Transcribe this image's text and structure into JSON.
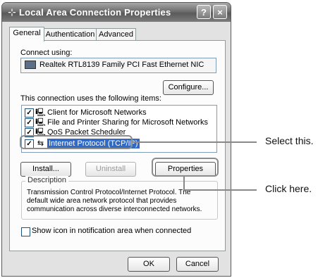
{
  "window": {
    "title": "Local Area Connection Properties",
    "help_button": "?",
    "close_button": "×"
  },
  "tabs": [
    {
      "label": "General",
      "active": true
    },
    {
      "label": "Authentication",
      "active": false
    },
    {
      "label": "Advanced",
      "active": false
    }
  ],
  "connect_using": {
    "label": "Connect using:",
    "adapter": "Realtek RTL8139 Family PCI Fast Ethernet NIC",
    "configure_button": "Configure..."
  },
  "items": {
    "label": "This connection uses the following items:",
    "list": [
      {
        "label": "Client for Microsoft Networks",
        "checked": true,
        "icon": "network-client-icon"
      },
      {
        "label": "File and Printer Sharing for Microsoft Networks",
        "checked": true,
        "icon": "file-printer-sharing-icon"
      },
      {
        "label": "QoS Packet Scheduler",
        "checked": true,
        "icon": "qos-scheduler-icon"
      },
      {
        "label": "Internet Protocol (TCP/IP)",
        "checked": true,
        "icon": "protocol-icon",
        "selected": true
      }
    ]
  },
  "buttons": {
    "install": "Install...",
    "uninstall": "Uninstall",
    "properties": "Properties",
    "ok": "OK",
    "cancel": "Cancel"
  },
  "description": {
    "legend": "Description",
    "text": "Transmission Control Protocol/Internet Protocol. The default wide area network protocol that provides communication across diverse interconnected networks."
  },
  "notification": {
    "label": "Show icon in notification area when connected",
    "checked": false
  },
  "callouts": {
    "select": "Select this.",
    "click": "Click here."
  },
  "colors": {
    "selection": "#316ac5",
    "callout_line": "#888888"
  }
}
